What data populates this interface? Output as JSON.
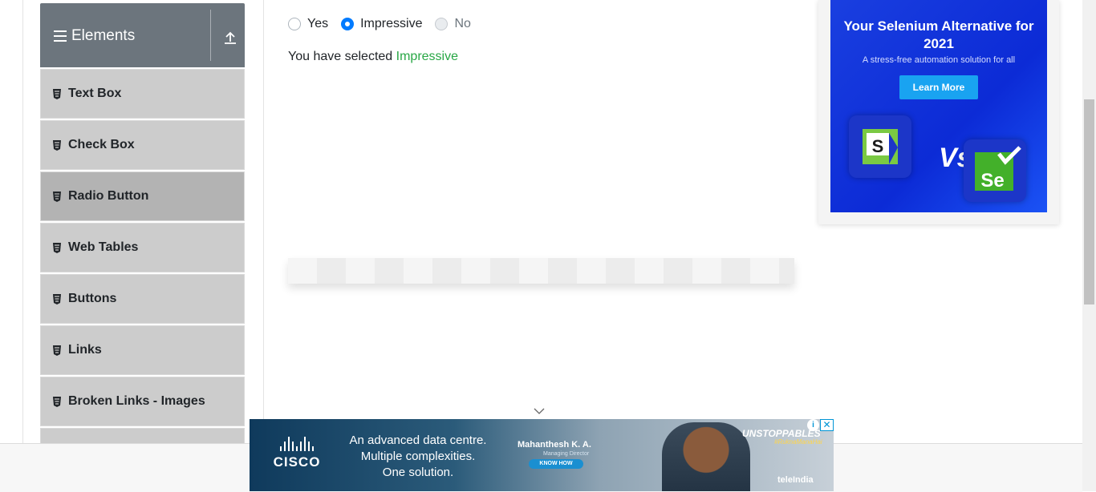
{
  "sidebar": {
    "group_title": "Elements",
    "items": [
      {
        "label": "Text Box"
      },
      {
        "label": "Check Box"
      },
      {
        "label": "Radio Button"
      },
      {
        "label": "Web Tables"
      },
      {
        "label": "Buttons"
      },
      {
        "label": "Links"
      },
      {
        "label": "Broken Links - Images"
      }
    ],
    "active_item": "Radio Button",
    "item_icon": "html5-icon"
  },
  "radio": {
    "options": [
      {
        "label": "Yes",
        "checked": false,
        "disabled": false
      },
      {
        "label": "Impressive",
        "checked": true,
        "disabled": false
      },
      {
        "label": "No",
        "checked": false,
        "disabled": true
      }
    ],
    "result_prefix": "You have selected",
    "result_value": "Impressive",
    "result_color": "#28a745",
    "accent": "#007bff"
  },
  "right_ad": {
    "headline": "Your Selenium Alternative for 2021",
    "subtext": "A stress-free automation solution for all",
    "cta": "Learn More",
    "vs_text": "Vs",
    "tile_left_letter": "S",
    "tile_right_letters": "Se"
  },
  "bottom_ad": {
    "logo": "CISCO",
    "line1": "An advanced data centre.",
    "line2": "Multiple complexities.",
    "line3": "One solution.",
    "person_name": "Mahanthesh K. A.",
    "person_title": "Managing Director",
    "cta": "KNOW HOW",
    "brand": "UNSTOPPABLES",
    "hashtag": "#RuknaManaHai",
    "partner": "teleIndia",
    "close_glyph": "✕",
    "info_glyph": "i"
  }
}
